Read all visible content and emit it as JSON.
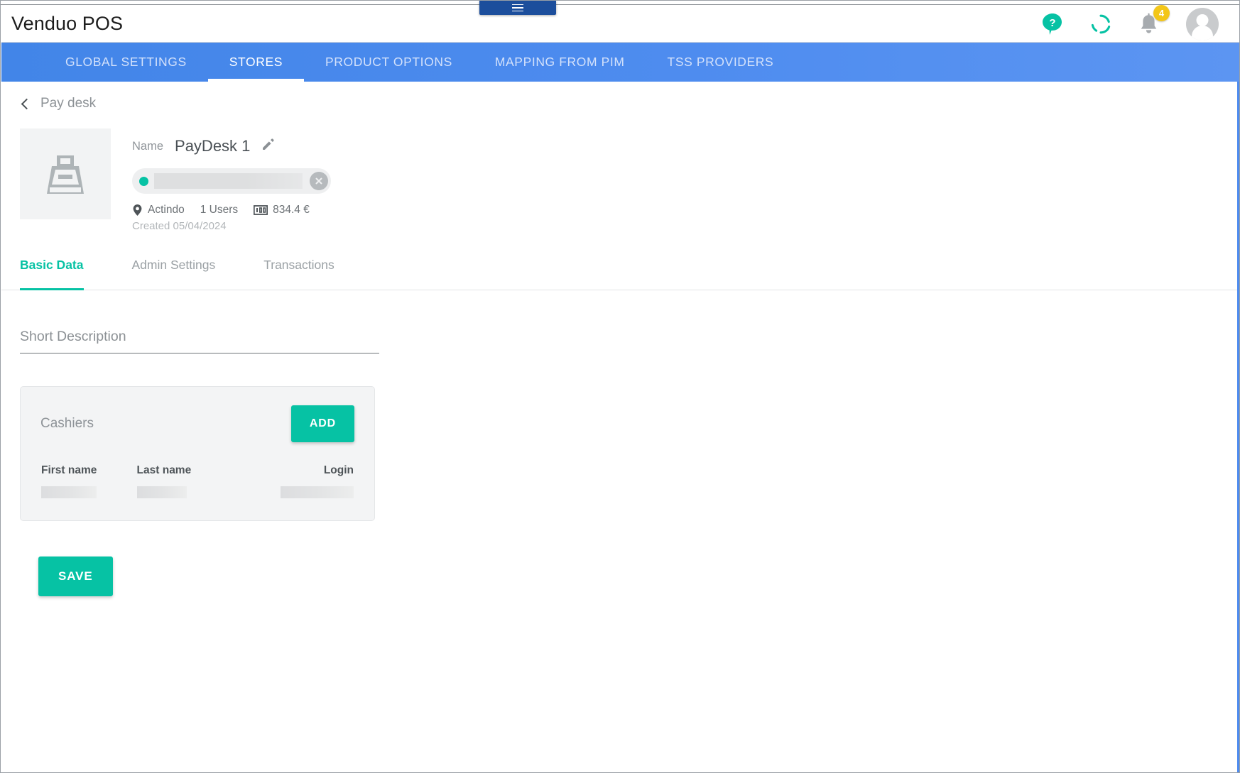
{
  "window": {
    "hamburger_tab_icon": "hamburger-menu-icon"
  },
  "header": {
    "app_title": "Venduo POS",
    "icons": {
      "help": "help-question-icon",
      "sync": "sync-spinner-icon",
      "notifications": "bell-icon",
      "notification_count": "4",
      "avatar": "user-avatar-icon"
    },
    "colors": {
      "accent_teal": "#06c2a4",
      "nav_blue": "#4e8cef",
      "badge_yellow": "#f3c618"
    }
  },
  "nav": {
    "items": [
      {
        "label": "GLOBAL SETTINGS",
        "active": false
      },
      {
        "label": "STORES",
        "active": true
      },
      {
        "label": "PRODUCT OPTIONS",
        "active": false
      },
      {
        "label": "MAPPING FROM PIM",
        "active": false
      },
      {
        "label": "TSS PROVIDERS",
        "active": false
      }
    ]
  },
  "breadcrumb": {
    "back_icon": "chevron-left-icon",
    "label": "Pay desk"
  },
  "summary": {
    "thumbnail_icon": "cash-register-icon",
    "name_label": "Name",
    "name_value": "PayDesk 1",
    "edit_icon": "pencil-edit-icon",
    "chip": {
      "status_dot_color": "#06c2a4",
      "close_icon": "close-circle-icon"
    },
    "meta": {
      "location_icon": "location-pin-icon",
      "location": "Actindo",
      "users": "1 Users",
      "balance_icon": "banknote-icon",
      "balance": "834.4 €"
    },
    "created": "Created 05/04/2024"
  },
  "tabs": [
    {
      "label": "Basic Data",
      "active": true
    },
    {
      "label": "Admin Settings",
      "active": false
    },
    {
      "label": "Transactions",
      "active": false
    }
  ],
  "form": {
    "short_description": {
      "placeholder": "Short Description",
      "value": ""
    },
    "cashiers_card": {
      "title": "Cashiers",
      "add_button": "ADD",
      "columns": [
        "First name",
        "Last name",
        "Login"
      ],
      "rows": [
        {
          "first_name": "",
          "last_name": "",
          "login": ""
        }
      ]
    },
    "save_button": "SAVE"
  }
}
